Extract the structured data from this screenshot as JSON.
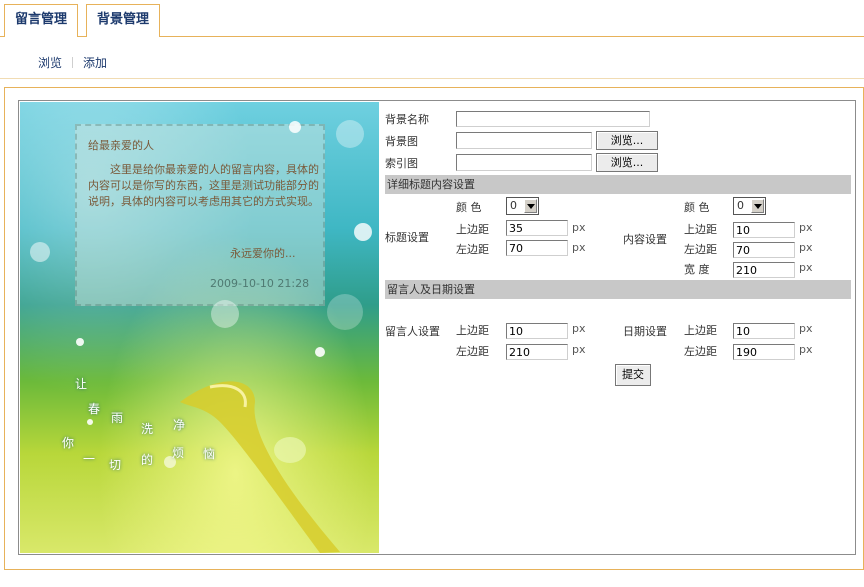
{
  "tabs": [
    "留言管理",
    "背景管理"
  ],
  "subnav": [
    "浏览",
    "添加"
  ],
  "preview": {
    "title": "给最亲爱的人",
    "body": "这里是给你最亲爱的人的留言内容，具体的内容可以是你写的东西，这里是测试功能部分的说明，具体的内容可以考虑用其它的方式实现。",
    "sign": "永远爱你的...",
    "date": "2009-10-10 21:28",
    "poem": [
      "让",
      "春",
      "雨",
      "洗",
      "净",
      "你",
      "一",
      "切",
      "的",
      "烦",
      "恼"
    ]
  },
  "form": {
    "bg_name_label": "背景名称",
    "bg_image_label": "背景图",
    "index_image_label": "索引图",
    "browse_label": "浏览...",
    "section_detail": "详细标题内容设置",
    "section_author": "留言人及日期设置",
    "color_label": "颜 色",
    "top_margin_label": "上边距",
    "left_margin_label": "左边距",
    "width_label": "宽 度",
    "unit": "px",
    "title_settings_label": "标题设置",
    "content_settings_label": "内容设置",
    "author_settings_label": "留言人设置",
    "date_settings_label": "日期设置",
    "title_color": "0",
    "title_top": "35",
    "title_left": "70",
    "content_color": "0",
    "content_top": "10",
    "content_left": "70",
    "content_width": "210",
    "author_top": "10",
    "author_left": "210",
    "date_top": "10",
    "date_left": "190",
    "submit_label": "提交"
  }
}
